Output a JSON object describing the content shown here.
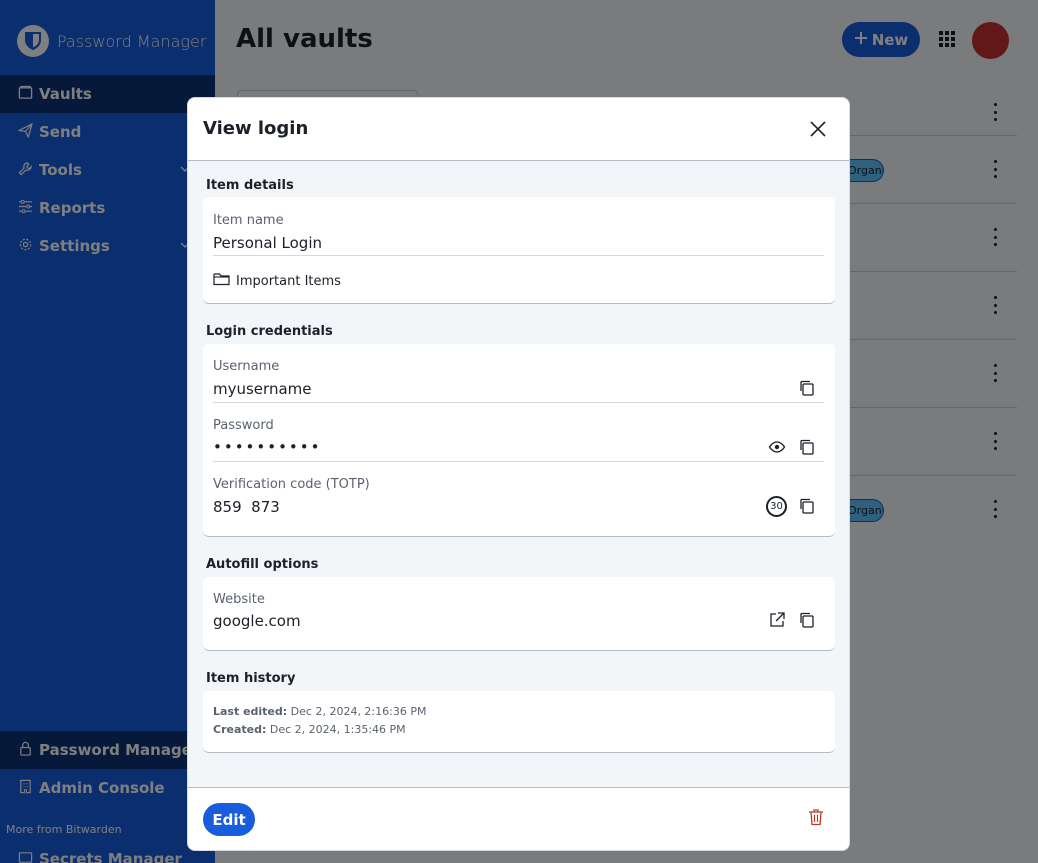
{
  "app": {
    "brand": "Password Manager"
  },
  "sidebar": {
    "items": [
      {
        "label": "Vaults",
        "icon": "vault-icon",
        "active": true
      },
      {
        "label": "Send",
        "icon": "send-icon"
      },
      {
        "label": "Tools",
        "icon": "wrench-icon",
        "expandable": true
      },
      {
        "label": "Reports",
        "icon": "sliders-icon"
      },
      {
        "label": "Settings",
        "icon": "gear-icon",
        "expandable": true
      }
    ],
    "products": [
      {
        "label": "Password Manager",
        "icon": "lock-icon",
        "active": true
      },
      {
        "label": "Admin Console",
        "icon": "building-icon"
      }
    ],
    "more_from": "More from Bitwarden",
    "secrets_manager": "Secrets Manager"
  },
  "header": {
    "title": "All vaults",
    "new_button": "New"
  },
  "vault_list": {
    "org_badge": "Organiz..."
  },
  "dialog": {
    "title": "View login",
    "item_details": {
      "heading": "Item details",
      "item_name_label": "Item name",
      "item_name_value": "Personal Login",
      "folder": "Important Items"
    },
    "login_credentials": {
      "heading": "Login credentials",
      "username_label": "Username",
      "username_value": "myusername",
      "password_label": "Password",
      "password_value": "••••••••••",
      "totp_label": "Verification code (TOTP)",
      "totp_value": "859  873",
      "totp_seconds": "30"
    },
    "autofill": {
      "heading": "Autofill options",
      "website_label": "Website",
      "website_value": "google.com"
    },
    "history": {
      "heading": "Item history",
      "last_edited_label": "Last edited:",
      "last_edited_value": "Dec 2, 2024, 2:16:36 PM",
      "created_label": "Created:",
      "created_value": "Dec 2, 2024, 1:35:46 PM"
    },
    "footer": {
      "edit_button": "Edit"
    }
  },
  "colors": {
    "primary": "#175ddc",
    "sidebar_active": "#0c3276",
    "danger": "#c83522",
    "avatar": "#c53030"
  }
}
